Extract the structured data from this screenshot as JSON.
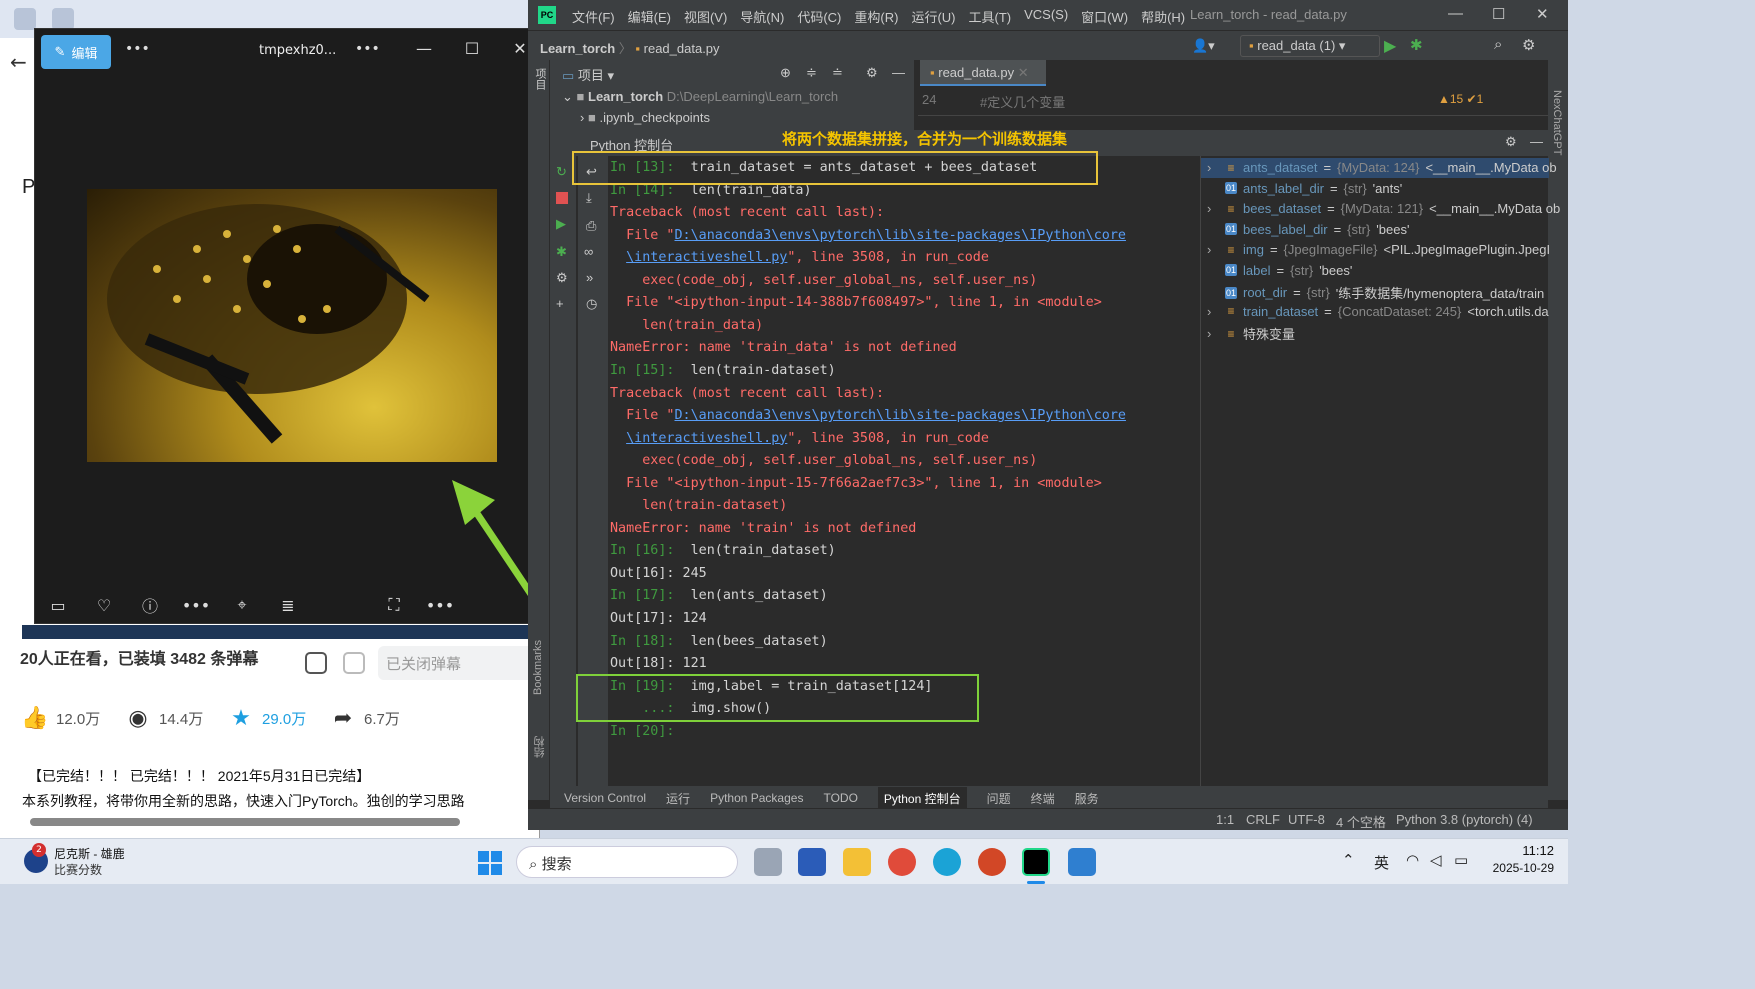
{
  "browser": {
    "stats": {
      "watching": "20人正在看，已装填",
      "count": "3482",
      "suffix": "条弹幕"
    },
    "danmu_closed": "已关闭弹幕",
    "actions": {
      "like": "12.0万",
      "coin": "14.4万",
      "fav": "29.0万",
      "share": "6.7万"
    },
    "desc1": "【已完结！！！ 已完结！！！ 2021年5月31日已完结】",
    "desc2": "本系列教程，将带你用全新的思路，快速入门PyTorch。独创的学习思路",
    "side_letter": "P"
  },
  "viewer": {
    "edit_label": "编辑",
    "filename": "tmpexhz0...",
    "more": "•••"
  },
  "ide": {
    "app_badge": "PC",
    "menu": [
      "文件(F)",
      "编辑(E)",
      "视图(V)",
      "导航(N)",
      "代码(C)",
      "重构(R)",
      "运行(U)",
      "工具(T)",
      "VCS(S)",
      "窗口(W)",
      "帮助(H)"
    ],
    "window_title": "Learn_torch - read_data.py",
    "breadcrumb": {
      "project": "Learn_torch",
      "file": "read_data.py"
    },
    "run_config": "read_data (1)",
    "project_header": "项目",
    "tree": {
      "root_name": "Learn_torch",
      "root_path": "D:\\DeepLearning\\Learn_torch",
      "child": ".ipynb_checkpoints"
    },
    "editor_tab": "read_data.py",
    "editor_line": {
      "num": "24",
      "text": "#定义几个变量",
      "warn": "▲15 ✔1"
    },
    "console_tab": "Python 控制台",
    "console_lines": [
      {
        "prompt": "In [13]:",
        "code": "train_dataset = ants_dataset + bees_dataset"
      },
      {
        "prompt": "In [14]:",
        "code": "len(train_data)"
      },
      {
        "err": "Traceback (most recent call last):"
      },
      {
        "err_pre": "  File \"",
        "link": "D:\\anaconda3\\envs\\pytorch\\lib\\site-packages\\IPython\\core"
      },
      {
        "err_pre": "  ",
        "link": "\\interactiveshell.py",
        "err_post": "\", line 3508, in run_code"
      },
      {
        "err": "    exec(code_obj, self.user_global_ns, self.user_ns)"
      },
      {
        "err": "  File \"<ipython-input-14-388b7f608497>\", line 1, in <module>"
      },
      {
        "err": "    len(train_data)"
      },
      {
        "err": "NameError: name 'train_data' is not defined"
      },
      {
        "prompt": "In [15]:",
        "code": "len(train-dataset)"
      },
      {
        "err": "Traceback (most recent call last):"
      },
      {
        "err_pre": "  File \"",
        "link": "D:\\anaconda3\\envs\\pytorch\\lib\\site-packages\\IPython\\core"
      },
      {
        "err_pre": "  ",
        "link": "\\interactiveshell.py",
        "err_post": "\", line 3508, in run_code"
      },
      {
        "err": "    exec(code_obj, self.user_global_ns, self.user_ns)"
      },
      {
        "err": "  File \"<ipython-input-15-7f66a2aef7c3>\", line 1, in <module>"
      },
      {
        "err": "    len(train-dataset)"
      },
      {
        "err": "NameError: name 'train' is not defined"
      },
      {
        "prompt": "In [16]:",
        "code": "len(train_dataset)"
      },
      {
        "out": "Out[16]: 245"
      },
      {
        "prompt": "In [17]:",
        "code": "len(ants_dataset)"
      },
      {
        "out": "Out[17]: 124"
      },
      {
        "prompt": "In [18]:",
        "code": "len(bees_dataset)"
      },
      {
        "out": "Out[18]: 121"
      },
      {
        "prompt": "In [19]:",
        "code": "img,label = train_dataset[124]"
      },
      {
        "prompt": "    ...:",
        "code": "img.show()"
      },
      {
        "prompt": "In [20]:",
        "code": ""
      }
    ],
    "annotation": "将两个数据集拼接，合并为一个训练数据集",
    "variables": [
      {
        "name": "ants_dataset",
        "type": "{MyData: 124}",
        "value": "<__main__.MyData ob",
        "expandable": true,
        "kind": "list"
      },
      {
        "name": "ants_label_dir",
        "type": "{str}",
        "value": "'ants'",
        "expandable": false,
        "kind": "str"
      },
      {
        "name": "bees_dataset",
        "type": "{MyData: 121}",
        "value": "<__main__.MyData ob",
        "expandable": true,
        "kind": "list"
      },
      {
        "name": "bees_label_dir",
        "type": "{str}",
        "value": "'bees'",
        "expandable": false,
        "kind": "str"
      },
      {
        "name": "img",
        "type": "{JpegImageFile}",
        "value": "<PIL.JpegImagePlugin.JpegI",
        "expandable": true,
        "kind": "list"
      },
      {
        "name": "label",
        "type": "{str}",
        "value": "'bees'",
        "expandable": false,
        "kind": "str"
      },
      {
        "name": "root_dir",
        "type": "{str}",
        "value": "'练手数据集/hymenoptera_data/train",
        "expandable": false,
        "kind": "str"
      },
      {
        "name": "train_dataset",
        "type": "{ConcatDataset: 245}",
        "value": "<torch.utils.da",
        "expandable": true,
        "kind": "list"
      },
      {
        "name": "特殊变量",
        "type": "",
        "value": "",
        "expandable": true,
        "kind": "list"
      }
    ],
    "bottom_tools": [
      "Version Control",
      "运行",
      "Python Packages",
      "TODO",
      "Python 控制台",
      "问题",
      "终端",
      "服务"
    ],
    "side_labels": {
      "project": "项目",
      "bookmarks": "Bookmarks",
      "structure": "结构",
      "nexchat": "NexChatGPT"
    },
    "status": {
      "pos": "1:1",
      "eol": "CRLF",
      "enc": "UTF-8",
      "indent": "4 个空格",
      "interp": "Python 3.8 (pytorch) (4)"
    }
  },
  "taskbar": {
    "badge": "2",
    "news_title": "尼克斯 - 雄鹿",
    "news_sub": "比赛分数",
    "search": "搜索",
    "ime": "英",
    "time": "11:12",
    "date": "2025-10-29"
  },
  "colors": {
    "accent": "#4a88c7",
    "error": "#ff6b68",
    "prompt": "#3f9a3f",
    "annot_yellow": "#f5c400",
    "box_yellow": "#e8c43a",
    "box_green": "#7fd13a",
    "arrow_green": "#8bd33a"
  }
}
